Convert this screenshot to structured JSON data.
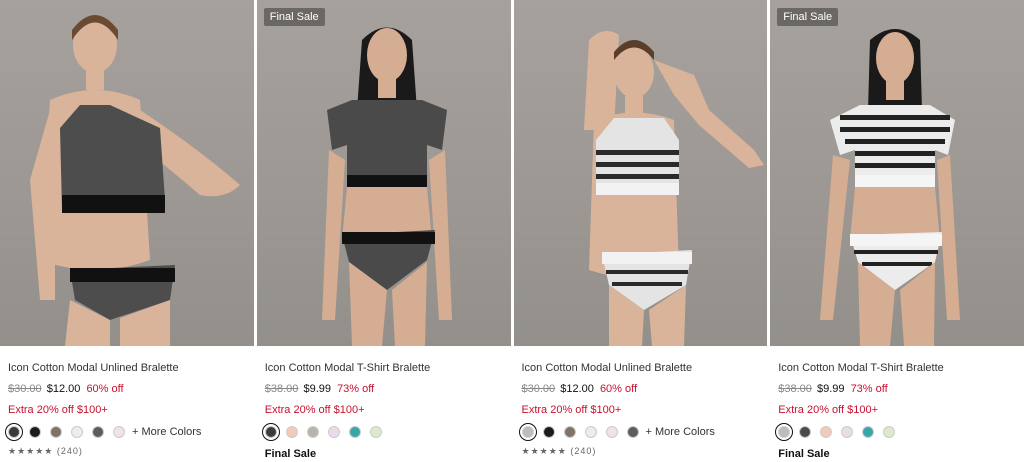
{
  "products": [
    {
      "name": "Icon Cotton Modal Unlined Bralette",
      "badge": "",
      "original_price": "$30.00",
      "sale_price": "$12.00",
      "discount": "60% off",
      "promo": "Extra 20% off $100+",
      "swatches": [
        "#3a3a3a",
        "#1b1b1b",
        "#807468",
        "#ececec",
        "#5d5d5d",
        "#efe3e3"
      ],
      "more_colors": "+ More Colors",
      "final_sale": "",
      "rating_count": "(240)"
    },
    {
      "name": "Icon Cotton Modal T-Shirt Bralette",
      "badge": "Final Sale",
      "original_price": "$38.00",
      "sale_price": "$9.99",
      "discount": "73% off",
      "promo": "Extra 20% off $100+",
      "swatches": [
        "#3c3c3c",
        "#f2cab9",
        "#b8b3ab",
        "#eadbea",
        "#3aa6a8",
        "#dde9cc"
      ],
      "more_colors": "",
      "final_sale": "Final Sale",
      "rating_count": ""
    },
    {
      "name": "Icon Cotton Modal Unlined Bralette",
      "badge": "",
      "original_price": "$30.00",
      "sale_price": "$12.00",
      "discount": "60% off",
      "promo": "Extra 20% off $100+",
      "swatches": [
        "#bdbdbd",
        "#1b1b1b",
        "#807468",
        "#ececec",
        "#efe3e3",
        "#5d5d5d"
      ],
      "more_colors": "+ More Colors",
      "final_sale": "",
      "rating_count": "(240)"
    },
    {
      "name": "Icon Cotton Modal T-Shirt Bralette",
      "badge": "Final Sale",
      "original_price": "$38.00",
      "sale_price": "$9.99",
      "discount": "73% off",
      "promo": "Extra 20% off $100+",
      "swatches": [
        "#bdbdbd",
        "#4a4a4a",
        "#f2cab9",
        "#eadbea",
        "#3aa6a8",
        "#dde9cc"
      ],
      "more_colors": "",
      "final_sale": "Final Sale",
      "rating_count": ""
    }
  ],
  "image_variants": [
    "gray",
    "charcoal",
    "stripe",
    "stripe"
  ],
  "colors": {
    "discount_red": "#c8102e",
    "badge_bg": "#6b6864",
    "backdrop": "#a19c98"
  }
}
